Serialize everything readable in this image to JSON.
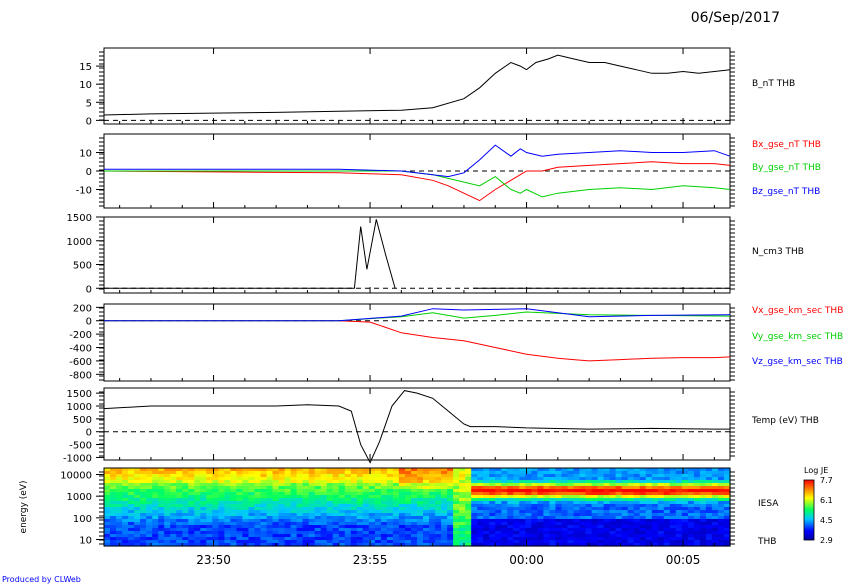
{
  "date": "06/Sep/2017",
  "footer": "Produced by CLWeb",
  "x_axis": {
    "tick_labels": [
      "23:50",
      "23:55",
      "00:00",
      "00:05"
    ],
    "tick_minutes": [
      -10,
      -5,
      0,
      5
    ],
    "range_minutes": [
      -13.5,
      6.5
    ]
  },
  "colors": {
    "red": "#ff0000",
    "green": "#00d000",
    "blue": "#0000ff",
    "black": "#000000"
  },
  "chart_data": [
    {
      "type": "line",
      "panel": "B_nT",
      "series": [
        {
          "name": "B_nT THB",
          "color": "#000000",
          "x": [
            -13.5,
            -12,
            -10,
            -8,
            -6,
            -4,
            -3,
            -2,
            -1.5,
            -1,
            -0.5,
            -0.2,
            0,
            0.3,
            0.7,
            1,
            1.5,
            2,
            2.5,
            3,
            3.5,
            4,
            4.5,
            5,
            5.5,
            6,
            6.5
          ],
          "y": [
            1.5,
            1.8,
            2,
            2.2,
            2.5,
            2.8,
            3.5,
            6,
            9,
            13,
            16,
            15,
            14,
            16,
            17,
            18,
            17,
            16,
            16,
            15,
            14,
            13,
            13,
            13.5,
            13,
            13.5,
            14
          ]
        }
      ],
      "ylim": [
        -1,
        20
      ],
      "y_ticks": [
        0,
        5,
        10,
        15
      ],
      "zero_dashed": true
    },
    {
      "type": "line",
      "panel": "B_gse_nT",
      "series": [
        {
          "name": "Bx_gse_nT THB",
          "color": "#ff0000",
          "x": [
            -13.5,
            -10,
            -6,
            -4,
            -3,
            -2.5,
            -2,
            -1.5,
            -1,
            -0.5,
            -0.2,
            0,
            0.5,
            1,
            2,
            3,
            4,
            5,
            6,
            6.5
          ],
          "y": [
            0,
            -0.5,
            -1,
            -2,
            -5,
            -8,
            -12,
            -16,
            -10,
            -5,
            -2,
            0,
            0,
            2,
            3,
            4,
            5,
            4,
            4,
            3
          ]
        },
        {
          "name": "By_gse_nT THB",
          "color": "#00d000",
          "x": [
            -13.5,
            -10,
            -6,
            -4,
            -3,
            -2.5,
            -2,
            -1.5,
            -1,
            -0.5,
            -0.2,
            0,
            0.5,
            1,
            2,
            3,
            4,
            5,
            6,
            6.5
          ],
          "y": [
            0,
            0,
            0,
            0,
            -2,
            -4,
            -6,
            -8,
            -3,
            -10,
            -12,
            -10,
            -14,
            -12,
            -10,
            -9,
            -10,
            -8,
            -9,
            -10
          ]
        },
        {
          "name": "Bz_gse_nT THB",
          "color": "#0000ff",
          "x": [
            -13.5,
            -10,
            -6,
            -4,
            -3,
            -2.5,
            -2,
            -1.5,
            -1,
            -0.5,
            -0.2,
            0,
            0.5,
            1,
            2,
            3,
            4,
            5,
            6,
            6.5
          ],
          "y": [
            1,
            1,
            1,
            0,
            -2,
            -3,
            -1,
            6,
            14,
            8,
            12,
            10,
            8,
            9,
            10,
            11,
            10,
            10,
            11,
            8
          ]
        }
      ],
      "ylim": [
        -20,
        20
      ],
      "y_ticks": [
        -10,
        0,
        10
      ],
      "zero_dashed": true
    },
    {
      "type": "line",
      "panel": "N_cm3",
      "series": [
        {
          "name": "N_cm3 THB",
          "color": "#000000",
          "x": [
            -13.5,
            -5.5,
            -5.3,
            -5.1,
            -4.8,
            -4.5,
            -4.2,
            -4.0,
            -1.8,
            -1.7,
            6.5
          ],
          "y": [
            0,
            0,
            1300,
            400,
            1450,
            700,
            0,
            null,
            null,
            0,
            0
          ]
        }
      ],
      "ylim": [
        -100,
        1500
      ],
      "y_ticks": [
        0,
        500,
        1000,
        1500
      ],
      "zero_dashed": true
    },
    {
      "type": "line",
      "panel": "V_gse_km_sec",
      "series": [
        {
          "name": "Vx_gse_km_sec THB",
          "color": "#ff0000",
          "x": [
            -13.5,
            -10,
            -6,
            -5,
            -4.5,
            -4,
            -3,
            -2,
            -1,
            0,
            1,
            1.5,
            2,
            3,
            4,
            5,
            6,
            6.5
          ],
          "y": [
            0,
            0,
            0,
            -20,
            -100,
            -180,
            -250,
            -300,
            -400,
            -500,
            -560,
            -580,
            -600,
            -580,
            -560,
            -550,
            -550,
            -540
          ]
        },
        {
          "name": "Vy_gse_km_sec THB",
          "color": "#00d000",
          "x": [
            -13.5,
            -10,
            -6,
            -4,
            -3,
            -2,
            -1,
            0,
            2,
            4,
            6.5
          ],
          "y": [
            0,
            0,
            0,
            60,
            120,
            40,
            80,
            130,
            90,
            80,
            70
          ]
        },
        {
          "name": "Vz_gse_km_sec THB",
          "color": "#0000ff",
          "x": [
            -13.5,
            -10,
            -6,
            -4,
            -3,
            -2,
            -1,
            0,
            2,
            4,
            6.5
          ],
          "y": [
            0,
            0,
            0,
            70,
            180,
            160,
            170,
            180,
            60,
            80,
            90
          ]
        }
      ],
      "ylim": [
        -900,
        250
      ],
      "y_ticks": [
        -800,
        -600,
        -400,
        -200,
        0,
        200
      ],
      "zero_dashed": true
    },
    {
      "type": "line",
      "panel": "Temp_eV",
      "series": [
        {
          "name": "Temp (eV) THB",
          "color": "#000000",
          "x": [
            -13.5,
            -12,
            -10,
            -8,
            -7,
            -6,
            -5.6,
            -5.3,
            -5.0,
            -4.7,
            -4.3,
            -3.9,
            -3.5,
            -3,
            -2.5,
            -2.0,
            -1.8,
            -1,
            0,
            2,
            4,
            6,
            6.5
          ],
          "y": [
            900,
            1000,
            1000,
            1000,
            1050,
            1000,
            800,
            -500,
            -1200,
            -400,
            1000,
            1600,
            1500,
            1300,
            800,
            300,
            200,
            200,
            150,
            100,
            130,
            100,
            100
          ]
        }
      ],
      "ylim": [
        -1100,
        1700
      ],
      "y_ticks": [
        -1000,
        -500,
        0,
        500,
        1000,
        1500
      ],
      "zero_dashed": true
    },
    {
      "type": "heatmap",
      "panel": "IESA energy spectrogram",
      "ylabel": "energy (eV)",
      "yscale": "log",
      "ylim": [
        5,
        20000
      ],
      "y_ticks": [
        10,
        100,
        1000,
        10000
      ],
      "series_label": "IESA",
      "probe_label": "THB",
      "colorbar": {
        "label": "Log JE",
        "min": 2.9,
        "max": 7.7,
        "ticks": [
          2.9,
          4.5,
          6.1,
          7.7
        ]
      }
    }
  ]
}
